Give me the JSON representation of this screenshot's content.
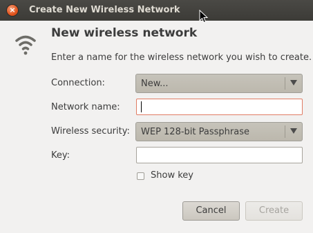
{
  "window": {
    "title": "Create New Wireless Network"
  },
  "dialog": {
    "heading": "New wireless network",
    "description": "Enter a name for the wireless network you wish to create."
  },
  "form": {
    "connection": {
      "label": "Connection:",
      "value": "New..."
    },
    "network_name": {
      "label": "Network name:",
      "value": ""
    },
    "wireless_security": {
      "label": "Wireless security:",
      "value": "WEP 128-bit Passphrase"
    },
    "key": {
      "label": "Key:",
      "value": ""
    },
    "show_key": {
      "label": "Show key",
      "checked": false
    }
  },
  "buttons": {
    "cancel": "Cancel",
    "create": "Create"
  },
  "icons": {
    "close": "close-icon",
    "wifi": "wifi-icon",
    "pointer": "mouse-pointer-icon"
  },
  "colors": {
    "titlebar": "#3c3b37",
    "close": "#e2531c",
    "focus_border": "#e07b63",
    "background": "#f2f1f0"
  }
}
